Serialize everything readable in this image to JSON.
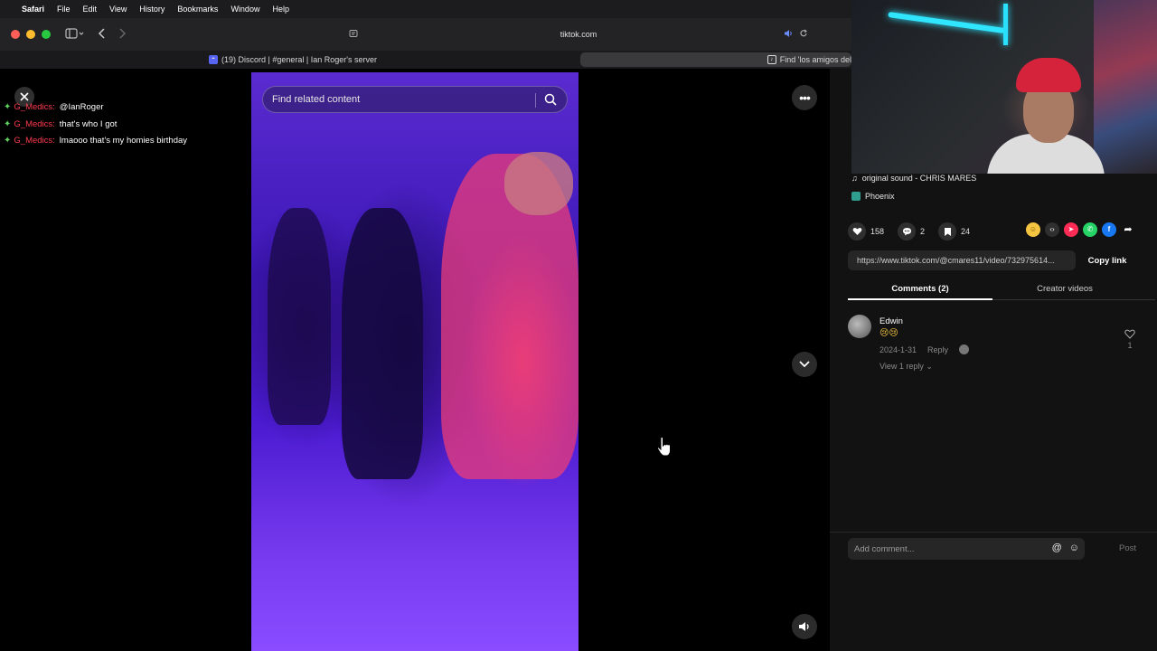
{
  "menubar": {
    "apple": "",
    "app": "Safari",
    "items": [
      "File",
      "Edit",
      "View",
      "History",
      "Bookmarks",
      "Window",
      "Help"
    ]
  },
  "browser": {
    "url": "tiktok.com",
    "tabs": [
      {
        "title": "(19) Discord | #general | Ian Roger's server"
      },
      {
        "title": "Find 'los amigos del"
      }
    ]
  },
  "chat": [
    {
      "user": "G_Medics:",
      "text": "@IanRoger"
    },
    {
      "user": "G_Medics:",
      "text": "that's who I got"
    },
    {
      "user": "G_Medics:",
      "text": "lmaooo that's my homies birthday"
    }
  ],
  "video": {
    "search_placeholder": "Find related content"
  },
  "details": {
    "sound": "original sound - CHRIS MARES",
    "location": "Phoenix",
    "likes": "158",
    "comments": "2",
    "saves": "24",
    "link": "https://www.tiktok.com/@cmares11/video/732975614...",
    "copy_link": "Copy link",
    "tab_comments": "Comments (2)",
    "tab_creator": "Creator videos"
  },
  "comments": [
    {
      "name": "Edwin",
      "emoji": "😢😢",
      "date": "2024-1-31",
      "reply": "Reply",
      "view_replies": "View 1 reply",
      "likes": "1"
    }
  ],
  "composer": {
    "placeholder": "Add comment...",
    "post": "Post"
  },
  "colors": {
    "chat_user": "#ff3b4e",
    "chat_badge": "#5ed35e",
    "panel_bg": "#121212"
  }
}
